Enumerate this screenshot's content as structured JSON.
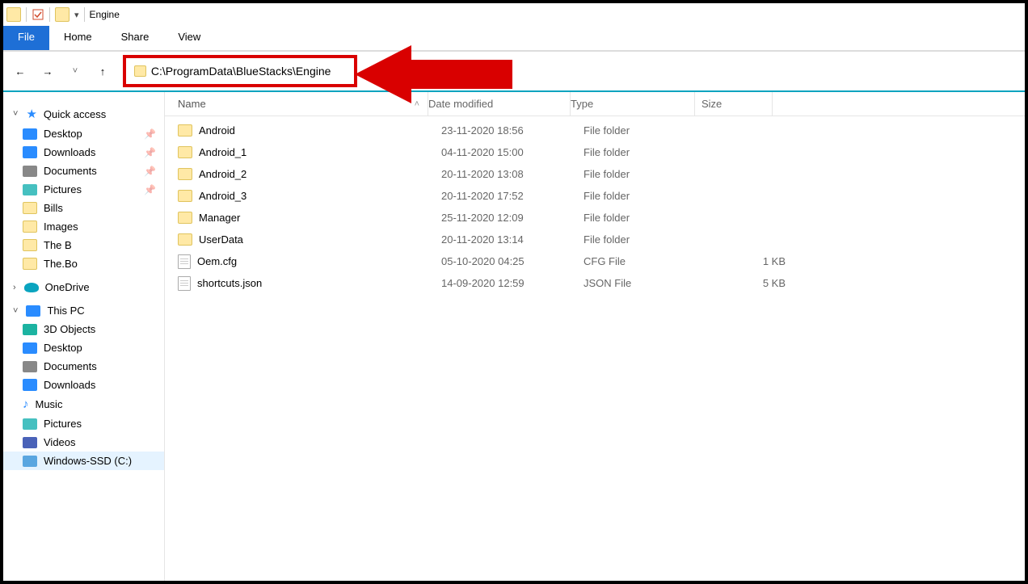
{
  "title": "Engine",
  "ribbon": {
    "file": "File",
    "home": "Home",
    "share": "Share",
    "view": "View"
  },
  "address_path": "C:\\ProgramData\\BlueStacks\\Engine",
  "columns": {
    "name": "Name",
    "date": "Date modified",
    "type": "Type",
    "size": "Size"
  },
  "sidebar": {
    "quick_access": "Quick access",
    "quick_items": [
      {
        "label": "Desktop",
        "icon": "desktop",
        "pinned": true
      },
      {
        "label": "Downloads",
        "icon": "download",
        "pinned": true
      },
      {
        "label": "Documents",
        "icon": "doc",
        "pinned": true
      },
      {
        "label": "Pictures",
        "icon": "pic",
        "pinned": true
      },
      {
        "label": "Bills",
        "icon": "folder",
        "pinned": false
      },
      {
        "label": "Images",
        "icon": "folder",
        "pinned": false
      },
      {
        "label": "The B",
        "icon": "folder",
        "pinned": false
      },
      {
        "label": "The.Bo",
        "icon": "folder",
        "pinned": false
      }
    ],
    "onedrive": "OneDrive",
    "this_pc": "This PC",
    "pc_items": [
      {
        "label": "3D Objects",
        "icon": "3d"
      },
      {
        "label": "Desktop",
        "icon": "desktop"
      },
      {
        "label": "Documents",
        "icon": "doc"
      },
      {
        "label": "Downloads",
        "icon": "download"
      },
      {
        "label": "Music",
        "icon": "music"
      },
      {
        "label": "Pictures",
        "icon": "pic"
      },
      {
        "label": "Videos",
        "icon": "video"
      },
      {
        "label": "Windows-SSD (C:)",
        "icon": "drive"
      }
    ]
  },
  "files": [
    {
      "name": "Android",
      "date": "23-11-2020 18:56",
      "type": "File folder",
      "size": "",
      "kind": "folder"
    },
    {
      "name": "Android_1",
      "date": "04-11-2020 15:00",
      "type": "File folder",
      "size": "",
      "kind": "folder"
    },
    {
      "name": "Android_2",
      "date": "20-11-2020 13:08",
      "type": "File folder",
      "size": "",
      "kind": "folder"
    },
    {
      "name": "Android_3",
      "date": "20-11-2020 17:52",
      "type": "File folder",
      "size": "",
      "kind": "folder"
    },
    {
      "name": "Manager",
      "date": "25-11-2020 12:09",
      "type": "File folder",
      "size": "",
      "kind": "folder"
    },
    {
      "name": "UserData",
      "date": "20-11-2020 13:14",
      "type": "File folder",
      "size": "",
      "kind": "folder"
    },
    {
      "name": "Oem.cfg",
      "date": "05-10-2020 04:25",
      "type": "CFG File",
      "size": "1 KB",
      "kind": "file"
    },
    {
      "name": "shortcuts.json",
      "date": "14-09-2020 12:59",
      "type": "JSON File",
      "size": "5 KB",
      "kind": "file"
    }
  ]
}
